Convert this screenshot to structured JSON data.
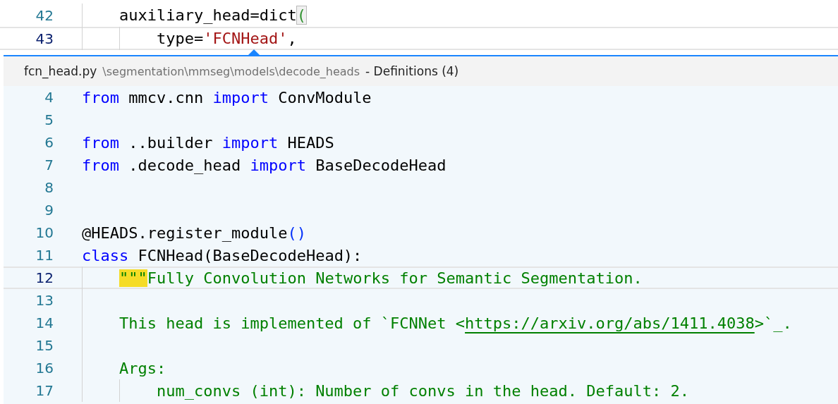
{
  "editor": {
    "lines": [
      {
        "number": "42",
        "current": false,
        "tokens": [
          {
            "text": "    auxiliary_head=dict",
            "kind": "plain"
          },
          {
            "text": "(",
            "kind": "bracket_match"
          }
        ]
      },
      {
        "number": "43",
        "current": true,
        "tokens": [
          {
            "text": "        type=",
            "kind": "plain"
          },
          {
            "text": "'FCNHead'",
            "kind": "string"
          },
          {
            "text": ",",
            "kind": "plain"
          }
        ]
      }
    ]
  },
  "peek": {
    "file": "fcn_head.py",
    "path": "\\segmentation\\mmseg\\models\\decode_heads",
    "title": "- Definitions (4)",
    "lines": [
      {
        "number": "4",
        "current": false,
        "tokens": [
          {
            "text": "from",
            "kind": "keyword"
          },
          {
            "text": " mmcv.cnn ",
            "kind": "plain"
          },
          {
            "text": "import",
            "kind": "keyword"
          },
          {
            "text": " ConvModule",
            "kind": "plain"
          }
        ]
      },
      {
        "number": "5",
        "current": false
      },
      {
        "number": "6",
        "current": false,
        "tokens": [
          {
            "text": "from",
            "kind": "keyword"
          },
          {
            "text": " ..builder ",
            "kind": "plain"
          },
          {
            "text": "import",
            "kind": "keyword"
          },
          {
            "text": " HEADS",
            "kind": "plain"
          }
        ]
      },
      {
        "number": "7",
        "current": false,
        "tokens": [
          {
            "text": "from",
            "kind": "keyword"
          },
          {
            "text": " .decode_head ",
            "kind": "plain"
          },
          {
            "text": "import",
            "kind": "keyword"
          },
          {
            "text": " BaseDecodeHead",
            "kind": "plain"
          }
        ]
      },
      {
        "number": "8",
        "current": false
      },
      {
        "number": "9",
        "current": false
      },
      {
        "number": "10",
        "current": false,
        "tokens": [
          {
            "text": "@HEADS.register_module",
            "kind": "plain"
          },
          {
            "text": "()",
            "kind": "bracket"
          }
        ]
      },
      {
        "number": "11",
        "current": false,
        "tokens": [
          {
            "text": "class",
            "kind": "keyword"
          },
          {
            "text": " FCNHead(BaseDecodeHead):",
            "kind": "plain"
          }
        ]
      },
      {
        "number": "12",
        "current": true,
        "tokens": [
          {
            "text": "    \"\"\"",
            "kind": "highlight"
          },
          {
            "text": "Fully Convolution Networks for Semantic Segmentation.",
            "kind": "docstring"
          }
        ]
      },
      {
        "number": "13",
        "current": false
      },
      {
        "number": "14",
        "current": false,
        "tokens": [
          {
            "text": "    This head is implemented of `FCNNet <",
            "kind": "docstring"
          },
          {
            "text": "https://arxiv.org/abs/1411.4038",
            "kind": "link"
          },
          {
            "text": ">`_.",
            "kind": "docstring"
          }
        ]
      },
      {
        "number": "15",
        "current": false
      },
      {
        "number": "16",
        "current": false,
        "tokens": [
          {
            "text": "    Args:",
            "kind": "docstring"
          }
        ]
      },
      {
        "number": "17",
        "current": false,
        "tokens": [
          {
            "text": "        num_convs (int): Number of convs in the head. Default: 2.",
            "kind": "docstring"
          }
        ]
      }
    ]
  }
}
